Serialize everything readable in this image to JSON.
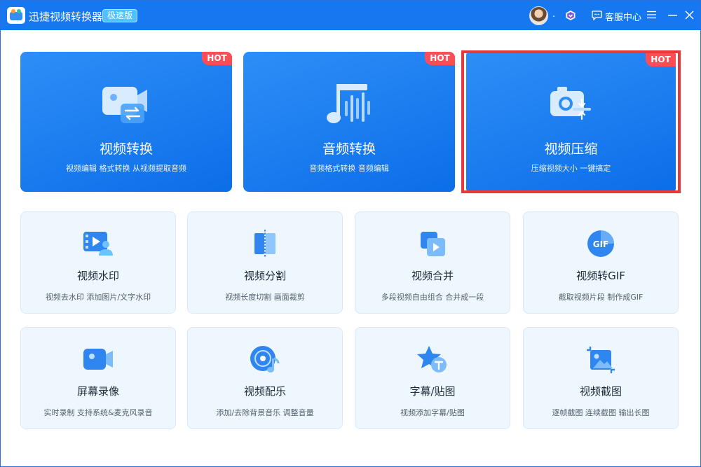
{
  "app": {
    "title": "迅捷视频转换器",
    "badge": "极速版",
    "username": ".",
    "service_label": "客服中心",
    "accent": "#1678f0",
    "hot_color": "#ff4d55"
  },
  "big_cards": [
    {
      "title": "视频转换",
      "desc": "视频编辑 格式转换 从视频提取音频",
      "hot": "HOT",
      "icon": "video-convert-icon"
    },
    {
      "title": "音频转换",
      "desc": "音频格式转换 音频编辑",
      "hot": "HOT",
      "icon": "music-note-icon"
    },
    {
      "title": "视频压缩",
      "desc": "压缩视频大小 一键搞定",
      "hot": "HOT",
      "icon": "camera-compress-icon",
      "selected": true
    }
  ],
  "small_cards": [
    {
      "title": "视频水印",
      "desc": "视频去水印 添加图片/文字水印",
      "icon": "film-watermark-icon"
    },
    {
      "title": "视频分割",
      "desc": "视频长度切割 画面裁剪",
      "icon": "split-icon"
    },
    {
      "title": "视频合并",
      "desc": "多段视频自由组合 合并成一段",
      "icon": "merge-icon"
    },
    {
      "title": "视频转GIF",
      "desc": "截取视频片段 制作成GIF",
      "icon": "gif-icon"
    },
    {
      "title": "屏幕录像",
      "desc": "实时录制 支持系统&麦克风录音",
      "icon": "screen-record-icon"
    },
    {
      "title": "视频配乐",
      "desc": "添加/去除背景音乐 调整音量",
      "icon": "music-disc-icon"
    },
    {
      "title": "字幕/贴图",
      "desc": "视频添加字幕/贴图",
      "icon": "star-text-icon"
    },
    {
      "title": "视频截图",
      "desc": "逐帧截图 连续截图 输出长图",
      "icon": "screenshot-icon"
    }
  ]
}
